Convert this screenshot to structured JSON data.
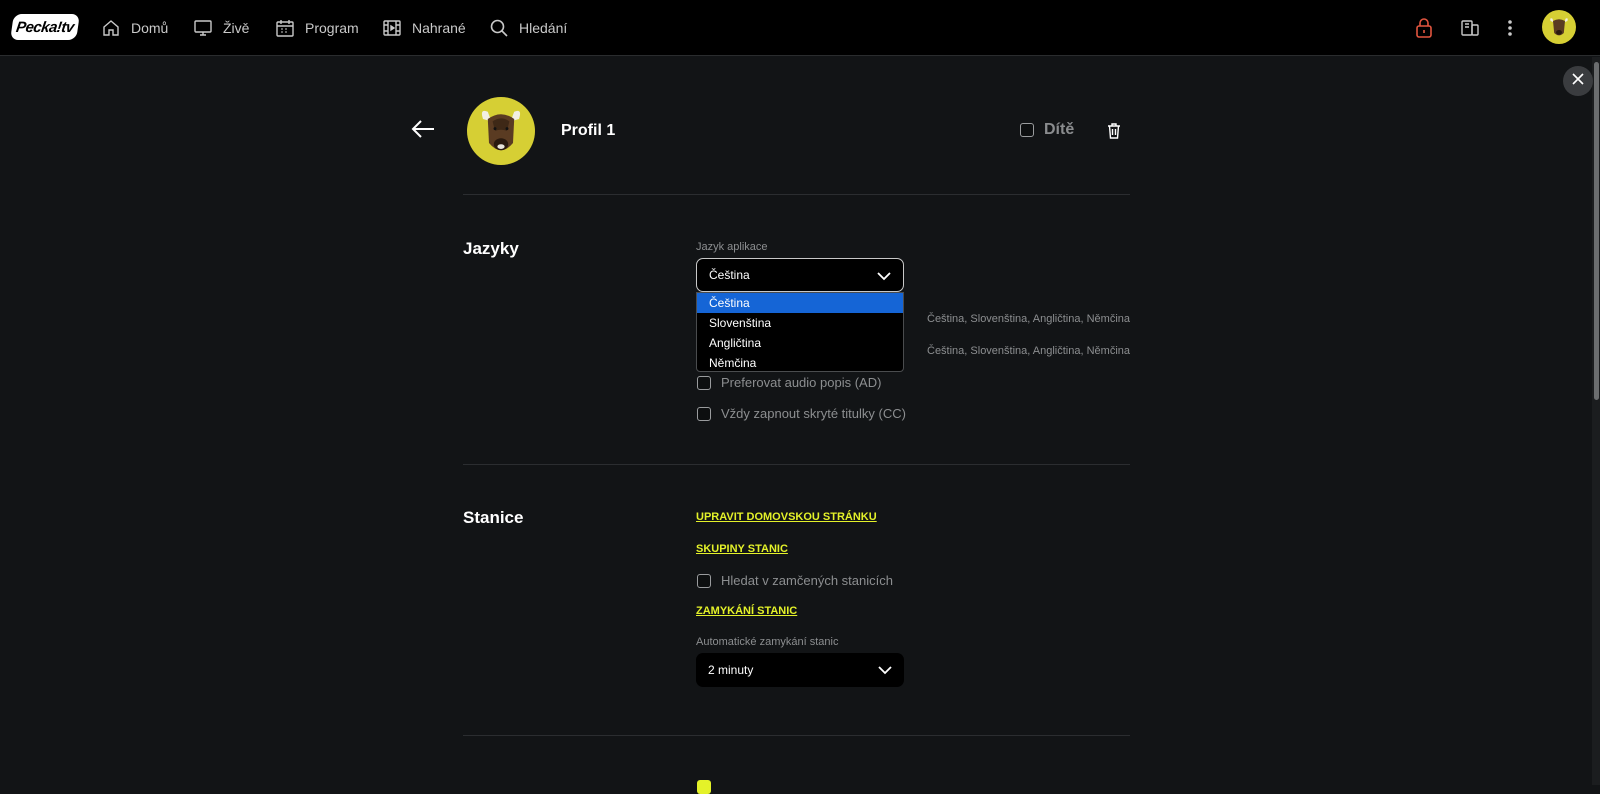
{
  "app": {
    "logo_text": "Pecka!tv"
  },
  "nav": {
    "items": [
      {
        "label": "Domů",
        "icon": "home-icon"
      },
      {
        "label": "Živě",
        "icon": "tv-icon"
      },
      {
        "label": "Program",
        "icon": "calendar-icon"
      },
      {
        "label": "Nahrané",
        "icon": "recordings-icon"
      },
      {
        "label": "Hledání",
        "icon": "search-icon"
      }
    ],
    "right_icons": [
      "lock-icon",
      "devices-icon",
      "more-vertical-icon"
    ],
    "lock_color": "#e2553f"
  },
  "profile": {
    "name": "Profil 1",
    "child_label": "Dítě",
    "child_checked": false
  },
  "languages": {
    "title": "Jazyky",
    "app_language_label": "Jazyk aplikace",
    "app_language_value": "Čeština",
    "dropdown_options": [
      "Čeština",
      "Slovenština",
      "Angličtina",
      "Němčina"
    ],
    "selected_option_index": 0,
    "audio_languages_value": "Čeština, Slovenština, Angličtina, Němčina",
    "subtitle_languages_value": "Čeština, Slovenština, Angličtina, Němčina",
    "prefer_audio_description": "Preferovat audio popis (AD)",
    "always_cc": "Vždy zapnout skryté titulky (CC)"
  },
  "stations": {
    "title": "Stanice",
    "edit_home_link": "UPRAVIT DOMOVSKOU STRÁNKU",
    "groups_link": "SKUPINY STANIC",
    "search_locked": "Hledat v zamčených stanicích",
    "locking_link": "ZAMYKÁNÍ STANIC",
    "auto_lock_label": "Automatické zamykání stanic",
    "auto_lock_value": "2 minuty"
  },
  "colors": {
    "accent_yellow": "#e4f229",
    "avatar_yellow": "#d6cf34",
    "selected_blue": "#1565d6",
    "background": "#121416"
  }
}
